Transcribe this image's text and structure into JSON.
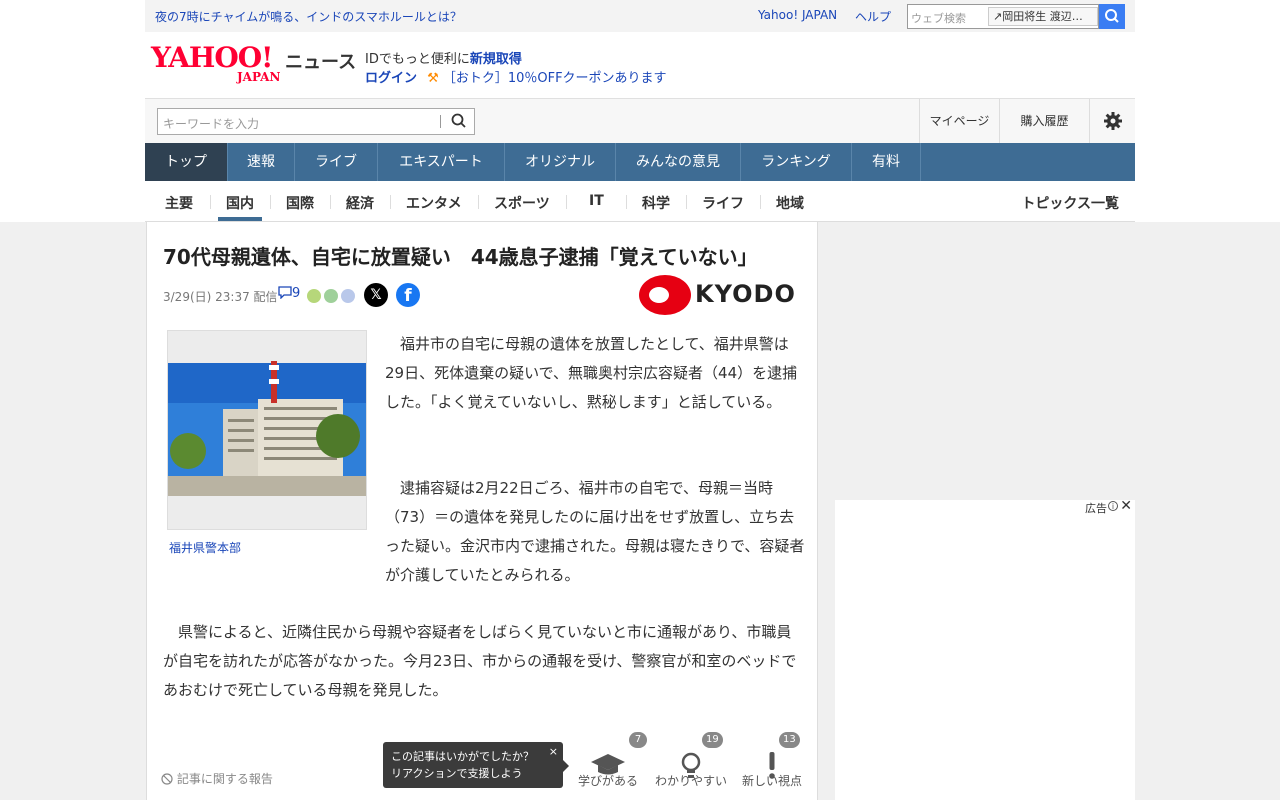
{
  "topbar": {
    "promo": "夜の7時にチャイムが鳴る、インドのスマホルールとは？",
    "yahoo_japan": "Yahoo! JAPAN",
    "help": "ヘルプ",
    "web_search_placeholder": "ウェブ検索",
    "search_tag": "岡田将生 渡辺…"
  },
  "header": {
    "logo_text": "YAHOO!",
    "logo_sub": "JAPAN",
    "news_label": "ニュース",
    "id_prefix": "IDでもっと便利に",
    "id_link": "新規取得",
    "login": "ログイン",
    "coupon": "［おトク］10％OFFクーポンあります"
  },
  "searchbar": {
    "placeholder": "キーワードを入力",
    "mypage": "マイページ",
    "history": "購入履歴"
  },
  "nav": {
    "tabs": [
      "トップ",
      "速報",
      "ライブ",
      "エキスパート",
      "オリジナル",
      "みんなの意見",
      "ランキング",
      "有料"
    ]
  },
  "subnav": {
    "items": [
      "主要",
      "国内",
      "国際",
      "経済",
      "エンタメ",
      "スポーツ",
      "IT",
      "科学",
      "ライフ",
      "地域"
    ],
    "topics": "トピックス一覧"
  },
  "article": {
    "title": "70代母親遺体、自宅に放置疑い　44歳息子逮捕「覚えていない」",
    "date": "3/29(日) 23:37",
    "delivered": "配信",
    "comment_count": "9",
    "source": "KYODO",
    "photo_caption": "福井県警本部",
    "paragraphs": [
      "　福井市の自宅に母親の遺体を放置したとして、福井県警は29日、死体遺棄の疑いで、無職奥村宗広容疑者（44）を逮捕した。「よく覚えていないし、黙秘します」と話している。",
      "　逮捕容疑は2月22日ごろ、福井市の自宅で、母親＝当時（73）＝の遺体を発見したのに届け出をせず放置し、立ち去った疑い。金沢市内で逮捕された。母親は寝たきりで、容疑者が介護していたとみられる。",
      "　県警によると、近隣住民から母親や容疑者をしばらく見ていないと市に通報があり、市職員が自宅を訪れたが応答がなかった。今月23日、市からの通報を受け、警察官が和室のベッドであおむけで死亡している母親を発見した。"
    ],
    "report": "記事に関する報告",
    "tooltip_line1": "この記事はいかがでしたか？",
    "tooltip_line2": "リアクションで支援しよう",
    "tooltip_close": "×",
    "reactions": [
      {
        "label": "学びがある",
        "count": "7",
        "icon": "graduation-cap-icon"
      },
      {
        "label": "わかりやすい",
        "count": "19",
        "icon": "lightbulb-icon"
      },
      {
        "label": "新しい視点",
        "count": "13",
        "icon": "exclamation-icon"
      }
    ]
  },
  "ad": {
    "label": "広告",
    "info": "i",
    "close": "✕"
  },
  "colors": {
    "yahoo_red": "#ff0033",
    "nav_blue": "#3e6c94",
    "nav_active": "#2f4152",
    "link_blue": "#1a46b8",
    "kyodo_red": "#e60012"
  }
}
